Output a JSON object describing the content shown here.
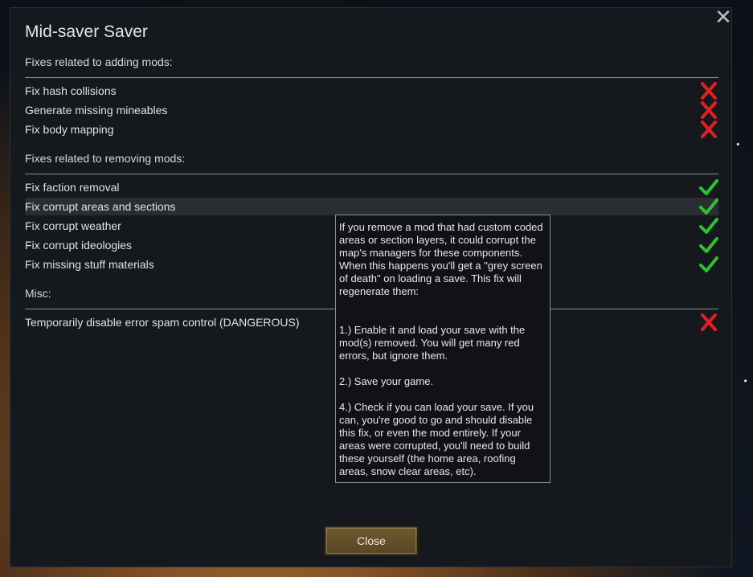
{
  "window": {
    "title": "Mid-saver Saver",
    "close_icon": "close-x-icon"
  },
  "sections": [
    {
      "header": "Fixes related to adding mods:",
      "items": [
        {
          "label": "Fix hash collisions",
          "enabled": false
        },
        {
          "label": "Generate missing mineables",
          "enabled": false
        },
        {
          "label": "Fix body mapping",
          "enabled": false
        }
      ]
    },
    {
      "header": "Fixes related to removing mods:",
      "items": [
        {
          "label": "Fix faction removal",
          "enabled": true
        },
        {
          "label": "Fix corrupt areas and sections",
          "enabled": true,
          "hovered": true
        },
        {
          "label": "Fix corrupt weather",
          "enabled": true
        },
        {
          "label": "Fix corrupt ideologies",
          "enabled": true
        },
        {
          "label": "Fix missing stuff materials",
          "enabled": true
        }
      ]
    },
    {
      "header": "Misc:",
      "items": [
        {
          "label": "Temporarily disable error spam control (DANGEROUS)",
          "enabled": false
        }
      ]
    }
  ],
  "tooltip": {
    "paragraphs": [
      "If you remove a mod that had custom coded areas or section layers, it could corrupt the map's managers for these components. When this happens you'll get a \"grey screen of death\" on loading a save. This fix will regenerate them:",
      "1.) Enable it and load your save with the mod(s) removed. You will get many red errors, but ignore them.",
      "2.) Save your game.",
      "4.) Check if you can load your save. If you can, you're good to go and should disable this fix, or even the mod entirely. If your areas were corrupted, you'll need to build these yourself (the home area, roofing areas, snow clear areas, etc)."
    ]
  },
  "footer": {
    "close_label": "Close"
  },
  "colors": {
    "check": "#2fc22f",
    "cross": "#e02020",
    "window_bg": "#15181c",
    "button_bg": "#6e5a32"
  }
}
